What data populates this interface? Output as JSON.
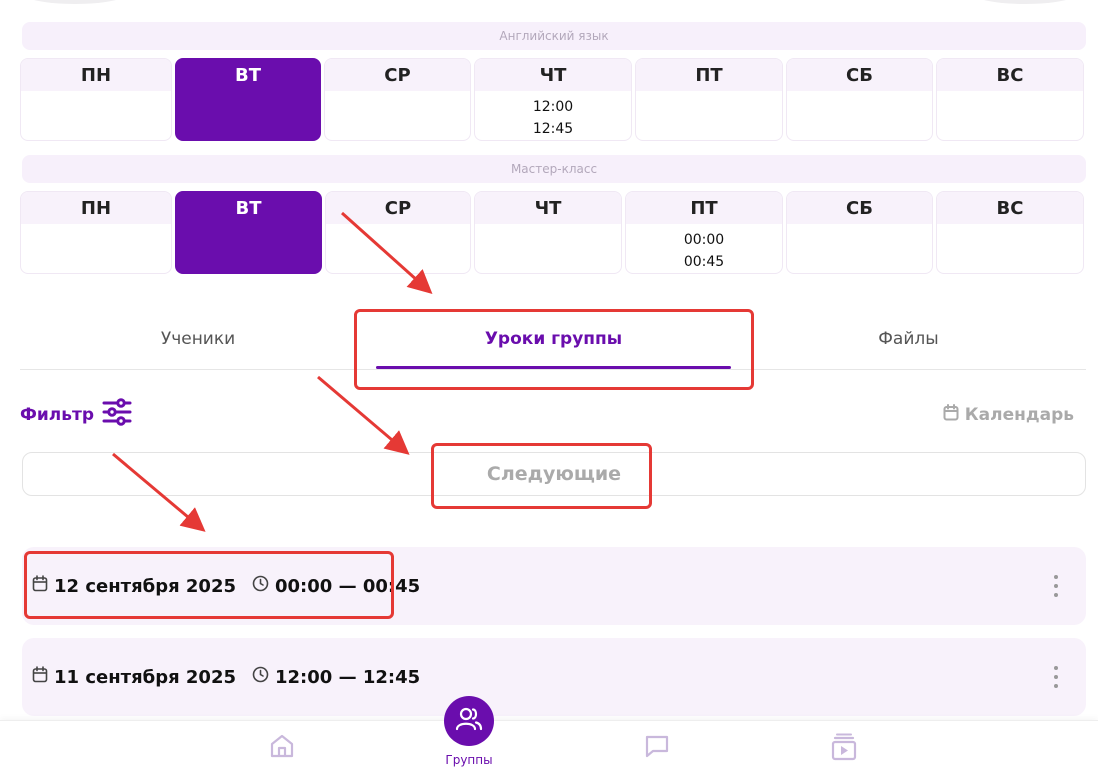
{
  "schedules": [
    {
      "course": "Английский язык",
      "days": [
        {
          "name": "ПН",
          "active": false,
          "times": []
        },
        {
          "name": "ВТ",
          "active": true,
          "times": []
        },
        {
          "name": "СР",
          "active": false,
          "times": []
        },
        {
          "name": "ЧТ",
          "active": false,
          "times": [
            "12:00",
            "12:45"
          ]
        },
        {
          "name": "ПТ",
          "active": false,
          "times": []
        },
        {
          "name": "СБ",
          "active": false,
          "times": []
        },
        {
          "name": "ВС",
          "active": false,
          "times": []
        }
      ]
    },
    {
      "course": "Мастер-класс",
      "days": [
        {
          "name": "ПН",
          "active": false,
          "times": []
        },
        {
          "name": "ВТ",
          "active": true,
          "times": []
        },
        {
          "name": "СР",
          "active": false,
          "times": []
        },
        {
          "name": "ЧТ",
          "active": false,
          "times": []
        },
        {
          "name": "ПТ",
          "active": false,
          "times": [
            "00:00",
            "00:45"
          ]
        },
        {
          "name": "СБ",
          "active": false,
          "times": []
        },
        {
          "name": "ВС",
          "active": false,
          "times": []
        }
      ]
    }
  ],
  "tabs": {
    "students": "Ученики",
    "lessons": "Уроки группы",
    "files": "Файлы"
  },
  "toolbar": {
    "filter": "Фильтр",
    "calendar": "Календарь"
  },
  "segment": {
    "label": "Следующие"
  },
  "lessons": [
    {
      "date": "12 сентября 2025",
      "time": "00:00 — 00:45"
    },
    {
      "date": "11 сентября 2025",
      "time": "12:00 — 12:45"
    }
  ],
  "bottom_nav": {
    "items": [
      {
        "icon": "home-icon"
      },
      {
        "icon": "groups-icon",
        "label": "Группы",
        "active": true
      },
      {
        "icon": "chat-icon"
      },
      {
        "icon": "media-library-icon"
      }
    ]
  },
  "colors": {
    "accent": "#6a0dad",
    "light_bg": "#f8f2fb",
    "annotation": "#e53935"
  }
}
